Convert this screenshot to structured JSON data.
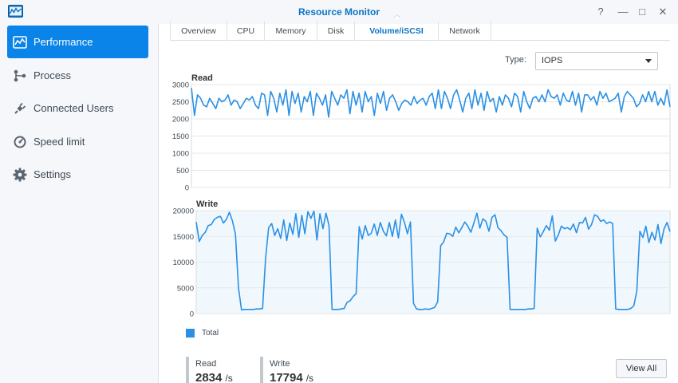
{
  "window": {
    "title": "Resource Monitor",
    "app_icon": "chart-window-icon",
    "controls": {
      "help": "?",
      "minimize": "—",
      "maximize": "□",
      "close": "✕"
    }
  },
  "sidebar": {
    "items": [
      {
        "label": "Performance",
        "icon": "performance-icon",
        "active": true
      },
      {
        "label": "Process",
        "icon": "process-icon",
        "active": false
      },
      {
        "label": "Connected Users",
        "icon": "plug-icon",
        "active": false
      },
      {
        "label": "Speed limit",
        "icon": "speedometer-icon",
        "active": false
      },
      {
        "label": "Settings",
        "icon": "gear-icon",
        "active": false
      }
    ]
  },
  "tabs": [
    {
      "label": "Overview",
      "active": false
    },
    {
      "label": "CPU",
      "active": false
    },
    {
      "label": "Memory",
      "active": false
    },
    {
      "label": "Disk",
      "active": false
    },
    {
      "label": "Volume/iSCSI",
      "active": true
    },
    {
      "label": "Network",
      "active": false
    }
  ],
  "type_selector": {
    "label": "Type:",
    "value": "IOPS"
  },
  "colors": {
    "accent": "#0a84e8",
    "series": "#2b90e5",
    "series_fill": "#f1f8fd"
  },
  "chart_data": [
    {
      "type": "line",
      "title": "Read",
      "ylim": [
        0,
        3000
      ],
      "yticks": [
        "0",
        "500",
        "1000",
        "1500",
        "2000",
        "2500",
        "3000"
      ],
      "grid": true,
      "series": [
        {
          "name": "Total",
          "values": [
            2900,
            2100,
            2700,
            2600,
            2400,
            2350,
            2600,
            2450,
            2300,
            2600,
            2500,
            2550,
            2700,
            2400,
            2550,
            2500,
            2300,
            2450,
            2600,
            2550,
            2650,
            2400,
            2300,
            2750,
            2700,
            2100,
            2800,
            2600,
            2200,
            2750,
            2400,
            2850,
            2100,
            2800,
            2450,
            2750,
            2200,
            2650,
            2500,
            2800,
            2100,
            2750,
            2600,
            2400,
            2700,
            2050,
            2800,
            2600,
            2400,
            2700,
            2600,
            2850,
            2150,
            2800,
            2400,
            2750,
            2200,
            2800,
            2500,
            2650,
            2100,
            2750,
            2450,
            2800,
            2250,
            2600,
            2700,
            2500,
            2250,
            2450,
            2550,
            2500,
            2400,
            2650,
            2450,
            2550,
            2600,
            2400,
            2650,
            2750,
            2300,
            2850,
            2300,
            2800,
            2600,
            2300,
            2700,
            2850,
            2550,
            2200,
            2600,
            2750,
            2300,
            2850,
            2400,
            2750,
            2250,
            2800,
            2500,
            2600,
            2200,
            2650,
            2400,
            2700,
            2600,
            2350,
            2750,
            2650,
            2200,
            2800,
            2500,
            2300,
            2600,
            2650,
            2500,
            2700,
            2500,
            2850,
            2650,
            2600,
            2700,
            2400,
            2750,
            2550,
            2500,
            2800,
            2400,
            2750,
            2200,
            2700,
            2700,
            2550,
            2650,
            2400,
            2800,
            2600,
            2750,
            2500,
            2550,
            2600,
            2750,
            2200,
            2650,
            2800,
            2700,
            2600,
            2350,
            2450,
            2700,
            2500,
            2800,
            2500,
            2800,
            2400,
            2600,
            2400,
            2850,
            2350
          ]
        }
      ]
    },
    {
      "type": "area",
      "title": "Write",
      "ylim": [
        0,
        20000
      ],
      "yticks": [
        "0",
        "5000",
        "10000",
        "15000",
        "20000"
      ],
      "grid": true,
      "legend": "bottom-left",
      "series": [
        {
          "name": "Total",
          "values": [
            17800,
            14000,
            15200,
            15800,
            17100,
            17300,
            18300,
            18700,
            18900,
            17600,
            18300,
            19700,
            18000,
            15400,
            5000,
            700,
            800,
            800,
            800,
            800,
            900,
            900,
            1000,
            10800,
            16700,
            17500,
            15200,
            16500,
            14600,
            18200,
            14200,
            17600,
            15400,
            19400,
            14800,
            19100,
            15500,
            19800,
            18500,
            19900,
            14300,
            19400,
            16500,
            19500,
            17100,
            800,
            800,
            800,
            900,
            1000,
            2200,
            2500,
            3300,
            3900,
            16900,
            14500,
            17100,
            15200,
            15600,
            17400,
            15200,
            17700,
            16000,
            15100,
            17700,
            15000,
            18200,
            14700,
            19300,
            17700,
            15500,
            17800,
            2000,
            900,
            800,
            800,
            900,
            800,
            1000,
            1200,
            2300,
            13200,
            13900,
            15600,
            15500,
            15000,
            16800,
            15700,
            16700,
            17800,
            17000,
            15800,
            17600,
            19500,
            16600,
            18400,
            17900,
            16000,
            18700,
            19200,
            16700,
            16100,
            15300,
            14800,
            800,
            800,
            800,
            800,
            800,
            800,
            900,
            900,
            1000,
            16600,
            14900,
            15900,
            17100,
            16200,
            19000,
            14100,
            15300,
            17000,
            16500,
            16700,
            16300,
            17400,
            15700,
            17700,
            17600,
            18700,
            16400,
            17300,
            19200,
            18900,
            17900,
            18200,
            17500,
            17800,
            17500,
            900,
            800,
            800,
            800,
            800,
            1000,
            1500,
            4400,
            16000,
            14800,
            17000,
            13800,
            15800,
            14300,
            17300,
            13600,
            16400,
            17700,
            15900
          ]
        }
      ]
    }
  ],
  "legend": {
    "label": "Total"
  },
  "stats": {
    "read": {
      "label": "Read",
      "value": "2834",
      "unit": "/s"
    },
    "write": {
      "label": "Write",
      "value": "17794",
      "unit": "/s"
    }
  },
  "view_all_label": "View All"
}
